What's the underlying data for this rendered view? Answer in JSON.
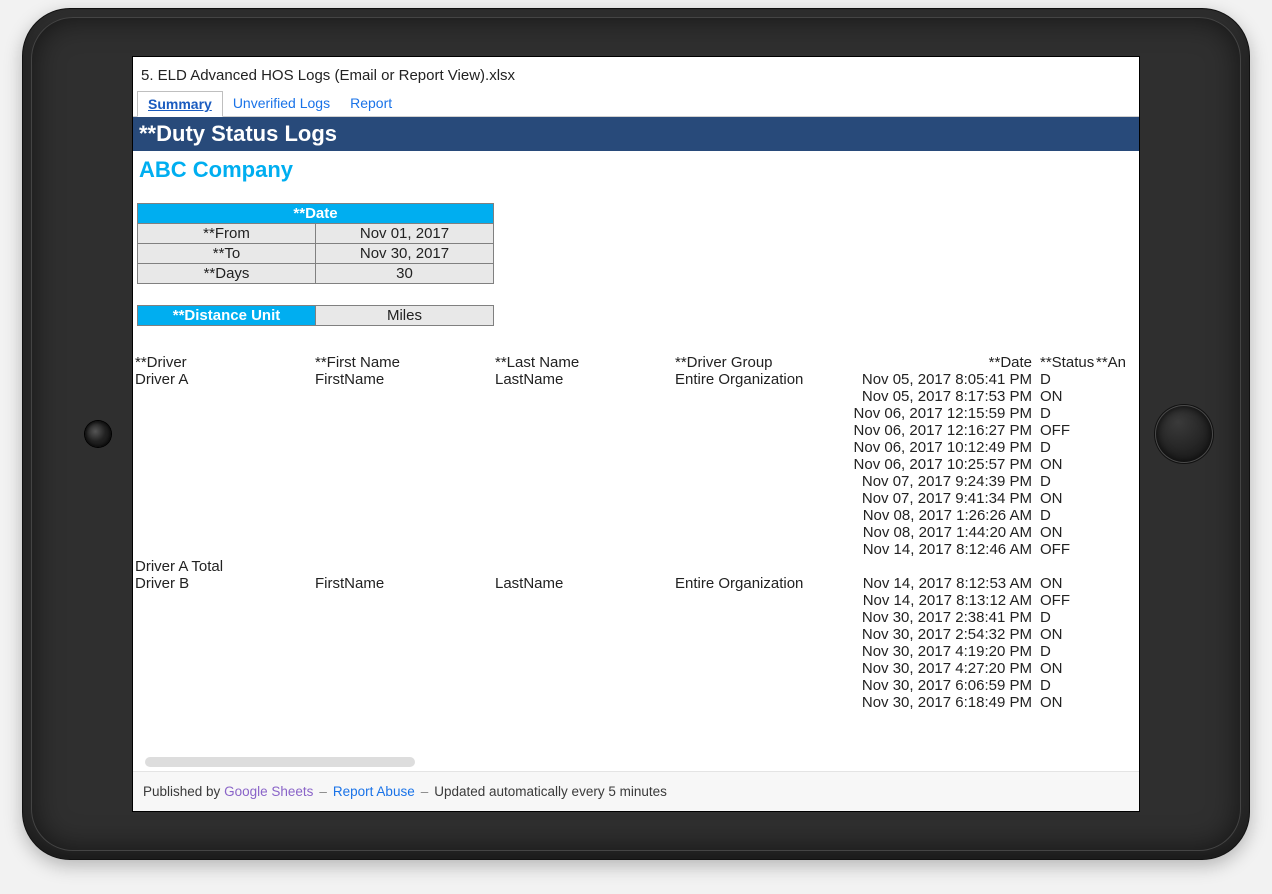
{
  "doc_title": "5. ELD Advanced HOS Logs (Email or Report View).xlsx",
  "tabs": [
    "Summary",
    "Unverified Logs",
    "Report"
  ],
  "active_tab_index": 0,
  "banner": "**Duty Status Logs",
  "company": "ABC Company",
  "params": {
    "date_header": "**Date",
    "from_label": "**From",
    "from_value": "Nov 01, 2017",
    "to_label": "**To",
    "to_value": "Nov 30, 2017",
    "days_label": "**Days",
    "days_value": "30",
    "distance_unit_label": "**Distance Unit",
    "distance_unit_value": "Miles"
  },
  "columns": {
    "driver": "**Driver",
    "first_name": "**First Name",
    "last_name": "**Last Name",
    "driver_group": "**Driver Group",
    "date": "**Date",
    "status": "**Status",
    "annotation": "**An"
  },
  "drivers": [
    {
      "driver": "Driver A",
      "first_name": "FirstName",
      "last_name": "LastName",
      "driver_group": "Entire Organization",
      "entries": [
        {
          "date": "Nov 05, 2017 8:05:41 PM",
          "status": "D"
        },
        {
          "date": "Nov 05, 2017 8:17:53 PM",
          "status": "ON"
        },
        {
          "date": "Nov 06, 2017 12:15:59 PM",
          "status": "D"
        },
        {
          "date": "Nov 06, 2017 12:16:27 PM",
          "status": "OFF"
        },
        {
          "date": "Nov 06, 2017 10:12:49 PM",
          "status": "D"
        },
        {
          "date": "Nov 06, 2017 10:25:57 PM",
          "status": "ON"
        },
        {
          "date": "Nov 07, 2017 9:24:39 PM",
          "status": "D"
        },
        {
          "date": "Nov 07, 2017 9:41:34 PM",
          "status": "ON"
        },
        {
          "date": "Nov 08, 2017 1:26:26 AM",
          "status": "D"
        },
        {
          "date": "Nov 08, 2017 1:44:20 AM",
          "status": "ON"
        },
        {
          "date": "Nov 14, 2017 8:12:46 AM",
          "status": "OFF"
        }
      ],
      "total_label": "Driver A Total"
    },
    {
      "driver": "Driver B",
      "first_name": "FirstName",
      "last_name": "LastName",
      "driver_group": "Entire Organization",
      "entries": [
        {
          "date": "Nov 14, 2017 8:12:53 AM",
          "status": "ON"
        },
        {
          "date": "Nov 14, 2017 8:13:12 AM",
          "status": "OFF"
        },
        {
          "date": "Nov 30, 2017 2:38:41 PM",
          "status": "D"
        },
        {
          "date": "Nov 30, 2017 2:54:32 PM",
          "status": "ON"
        },
        {
          "date": "Nov 30, 2017 4:19:20 PM",
          "status": "D"
        },
        {
          "date": "Nov 30, 2017 4:27:20 PM",
          "status": "ON"
        },
        {
          "date": "Nov 30, 2017 6:06:59 PM",
          "status": "D"
        },
        {
          "date": "Nov 30, 2017 6:18:49 PM",
          "status": "ON"
        }
      ]
    }
  ],
  "footer": {
    "published_by": "Published by",
    "google_sheets": "Google Sheets",
    "report_abuse": "Report Abuse",
    "updated": "Updated automatically every 5 minutes"
  }
}
